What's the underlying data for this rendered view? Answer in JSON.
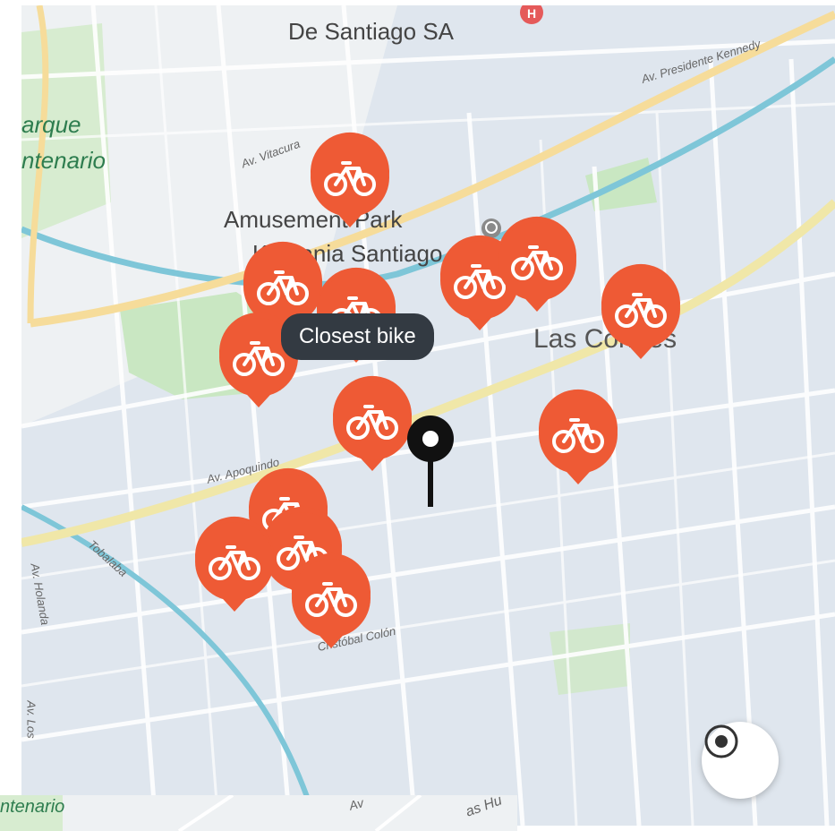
{
  "map": {
    "poi_top": "De Santiago SA",
    "park_line1": "arque",
    "park_line2": "ntenario",
    "poi_amusement": "Amusement Park",
    "poi_kidzania": "KidZania Santiago",
    "district": "Las Condes",
    "streets": {
      "vitacura": "Av. Vitacura",
      "kennedy": "Av. Presidente Kennedy",
      "apoquindo": "Av. Apoquindo",
      "tobalaba": "Tobalaba",
      "holanda": "Av. Holanda",
      "colon": "Cristóbal Colón",
      "los": "Av. Los"
    },
    "tooltip": "Closest bike",
    "marker_icon": "bicycle-icon",
    "marker_color": "#ee5a35",
    "hospital_icon": "hospital-icon",
    "locate_icon": "my-location-icon"
  },
  "inset": {
    "park_label": "ntenario",
    "street_fragment": "as Hu",
    "street_fragment_2": "Av"
  },
  "colors": {
    "marker": "#ee5a35",
    "tooltip_bg": "#333a42",
    "water": "#7ec6d8",
    "park": "#c9e7c2",
    "major_road": "#f6dc9a"
  }
}
